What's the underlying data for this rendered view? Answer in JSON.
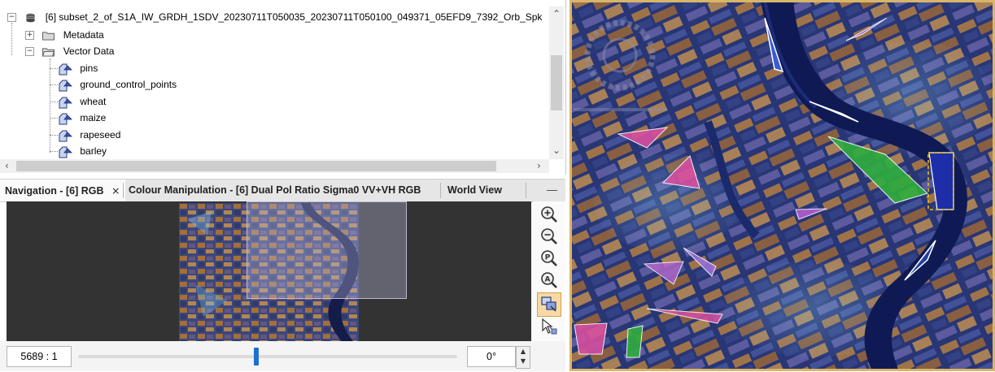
{
  "tree": {
    "product": "[6] subset_2_of_S1A_IW_GRDH_1SDV_20230711T050035_20230711T050100_049371_05EFD9_7392_Orb_Spk",
    "metadata": "Metadata",
    "vector_data": "Vector Data",
    "vectors": [
      "pins",
      "ground_control_points",
      "wheat",
      "maize",
      "rapeseed",
      "barley"
    ],
    "expand_glyph": "+",
    "collapse_glyph": "−"
  },
  "tabs": [
    {
      "label": "Navigation - [6] RGB",
      "close": "×",
      "active": true
    },
    {
      "label": "Colour Manipulation - [6] Dual Pol Ratio Sigma0 VV+VH RGB",
      "active": false
    },
    {
      "label": "World View",
      "active": false
    }
  ],
  "tabs_minimize": "—",
  "navigation": {
    "scale": "5689 : 1",
    "rotation": "0°",
    "slider_fraction": 0.47,
    "help_glyph": "?"
  },
  "icons": {
    "zoom_in": "zoom-in-icon",
    "zoom_out": "zoom-out-icon",
    "zoom_pixel": "zoom-pixel-icon",
    "zoom_all": "zoom-all-icon",
    "sync_views": "sync-views-icon",
    "sync_cursor": "sync-cursor-icon",
    "help": "help-icon"
  },
  "colors": {
    "polygon_magenta": "#d64fa0",
    "polygon_green": "#2fae3e",
    "polygon_violet": "#9c6fd6",
    "selection_yellow": "#f2c200",
    "nav_bg": "#333333",
    "viewport_box": "#9b97b4"
  }
}
